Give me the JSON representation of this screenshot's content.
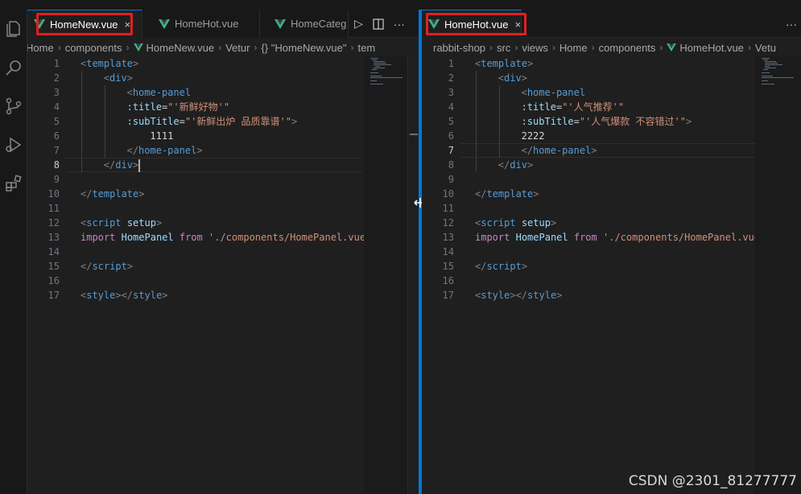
{
  "left": {
    "tabs": [
      {
        "label": "HomeNew.vue",
        "active": true,
        "close": "×"
      },
      {
        "label": "HomeHot.vue",
        "active": false
      },
      {
        "label": "HomeCateg",
        "active": false
      }
    ],
    "breadcrumb": [
      "Home",
      "components",
      "HomeNew.vue",
      "Vetur",
      "{} \"HomeNew.vue\"",
      "tem"
    ],
    "cursor_line": 8,
    "lines": [
      {
        "n": "1",
        "tokens": [
          [
            "t-brk",
            "<"
          ],
          [
            "t-tag",
            "template"
          ],
          [
            "t-brk",
            ">"
          ]
        ]
      },
      {
        "n": "2",
        "indent": 1,
        "tokens": [
          [
            "t-brk",
            "<"
          ],
          [
            "t-tag",
            "div"
          ],
          [
            "t-brk",
            ">"
          ]
        ]
      },
      {
        "n": "3",
        "indent": 2,
        "tokens": [
          [
            "t-brk",
            "<"
          ],
          [
            "t-tag",
            "home-panel"
          ]
        ]
      },
      {
        "n": "4",
        "indent": 2,
        "tokens": [
          [
            "t-attr",
            ":title"
          ],
          [
            "t-txt",
            "="
          ],
          [
            "t-str",
            "\"'新鲜好物'\""
          ]
        ]
      },
      {
        "n": "5",
        "indent": 2,
        "tokens": [
          [
            "t-attr",
            ":subTitle"
          ],
          [
            "t-txt",
            "="
          ],
          [
            "t-str",
            "\"'新鲜出炉 品质靠谱'\""
          ],
          [
            "t-brk",
            ">"
          ]
        ]
      },
      {
        "n": "6",
        "indent": 3,
        "tokens": [
          [
            "t-txt",
            "1111"
          ]
        ]
      },
      {
        "n": "7",
        "indent": 2,
        "tokens": [
          [
            "t-brk",
            "</"
          ],
          [
            "t-tag",
            "home-panel"
          ],
          [
            "t-brk",
            ">"
          ]
        ]
      },
      {
        "n": "8",
        "indent": 1,
        "tokens": [
          [
            "t-brk",
            "</"
          ],
          [
            "t-tag",
            "div"
          ],
          [
            "t-brk",
            ">"
          ]
        ],
        "cursor": true
      },
      {
        "n": "9",
        "tokens": []
      },
      {
        "n": "10",
        "tokens": [
          [
            "t-brk",
            "</"
          ],
          [
            "t-tag",
            "template"
          ],
          [
            "t-brk",
            ">"
          ]
        ]
      },
      {
        "n": "11",
        "tokens": []
      },
      {
        "n": "12",
        "tokens": [
          [
            "t-brk",
            "<"
          ],
          [
            "t-tag",
            "script"
          ],
          [
            "t-txt",
            " "
          ],
          [
            "t-sup",
            "setup"
          ],
          [
            "t-brk",
            ">"
          ]
        ]
      },
      {
        "n": "13",
        "tokens": [
          [
            "t-kw",
            "import"
          ],
          [
            "t-txt",
            " "
          ],
          [
            "t-var",
            "HomePanel"
          ],
          [
            "t-txt",
            " "
          ],
          [
            "t-kw",
            "from"
          ],
          [
            "t-txt",
            " "
          ],
          [
            "t-str",
            "'./components/HomePanel.vue"
          ]
        ]
      },
      {
        "n": "14",
        "tokens": []
      },
      {
        "n": "15",
        "tokens": [
          [
            "t-brk",
            "</"
          ],
          [
            "t-tag",
            "script"
          ],
          [
            "t-brk",
            ">"
          ]
        ]
      },
      {
        "n": "16",
        "tokens": []
      },
      {
        "n": "17",
        "tokens": [
          [
            "t-brk",
            "<"
          ],
          [
            "t-tag",
            "style"
          ],
          [
            "t-brk",
            "></"
          ],
          [
            "t-tag",
            "style"
          ],
          [
            "t-brk",
            ">"
          ]
        ]
      }
    ]
  },
  "right": {
    "tabs": [
      {
        "label": "HomeHot.vue",
        "active": true,
        "close": "×"
      }
    ],
    "breadcrumb": [
      "rabbit-shop",
      "src",
      "views",
      "Home",
      "components",
      "HomeHot.vue",
      "Vetu"
    ],
    "cursor_line": 7,
    "lines": [
      {
        "n": "1",
        "tokens": [
          [
            "t-brk",
            "<"
          ],
          [
            "t-tag",
            "template"
          ],
          [
            "t-brk",
            ">"
          ]
        ]
      },
      {
        "n": "2",
        "indent": 1,
        "tokens": [
          [
            "t-brk",
            "<"
          ],
          [
            "t-tag",
            "div"
          ],
          [
            "t-brk",
            ">"
          ]
        ]
      },
      {
        "n": "3",
        "indent": 2,
        "tokens": [
          [
            "t-brk",
            "<"
          ],
          [
            "t-tag",
            "home-panel"
          ]
        ]
      },
      {
        "n": "4",
        "indent": 2,
        "tokens": [
          [
            "t-attr",
            ":title"
          ],
          [
            "t-txt",
            "="
          ],
          [
            "t-str",
            "\"'人气推荐'\""
          ]
        ]
      },
      {
        "n": "5",
        "indent": 2,
        "tokens": [
          [
            "t-attr",
            ":subTitle"
          ],
          [
            "t-txt",
            "="
          ],
          [
            "t-str",
            "\"'人气爆款 不容错过'\""
          ],
          [
            "t-brk",
            ">"
          ]
        ]
      },
      {
        "n": "6",
        "indent": 2,
        "tokens": [
          [
            "t-txt",
            "2222"
          ]
        ]
      },
      {
        "n": "7",
        "indent": 2,
        "tokens": [
          [
            "t-brk",
            "</"
          ],
          [
            "t-tag",
            "home-panel"
          ],
          [
            "t-brk",
            ">"
          ]
        ]
      },
      {
        "n": "8",
        "indent": 1,
        "tokens": [
          [
            "t-brk",
            "</"
          ],
          [
            "t-tag",
            "div"
          ],
          [
            "t-brk",
            ">"
          ]
        ]
      },
      {
        "n": "9",
        "tokens": []
      },
      {
        "n": "10",
        "tokens": [
          [
            "t-brk",
            "</"
          ],
          [
            "t-tag",
            "template"
          ],
          [
            "t-brk",
            ">"
          ]
        ]
      },
      {
        "n": "11",
        "tokens": []
      },
      {
        "n": "12",
        "tokens": [
          [
            "t-brk",
            "<"
          ],
          [
            "t-tag",
            "script"
          ],
          [
            "t-txt",
            " "
          ],
          [
            "t-sup",
            "setup"
          ],
          [
            "t-brk",
            ">"
          ]
        ]
      },
      {
        "n": "13",
        "tokens": [
          [
            "t-kw",
            "import"
          ],
          [
            "t-txt",
            " "
          ],
          [
            "t-var",
            "HomePanel"
          ],
          [
            "t-txt",
            " "
          ],
          [
            "t-kw",
            "from"
          ],
          [
            "t-txt",
            " "
          ],
          [
            "t-str",
            "'./components/HomePanel.vue"
          ]
        ]
      },
      {
        "n": "14",
        "tokens": []
      },
      {
        "n": "15",
        "tokens": [
          [
            "t-brk",
            "</"
          ],
          [
            "t-tag",
            "script"
          ],
          [
            "t-brk",
            ">"
          ]
        ]
      },
      {
        "n": "16",
        "tokens": []
      },
      {
        "n": "17",
        "tokens": [
          [
            "t-brk",
            "<"
          ],
          [
            "t-tag",
            "style"
          ],
          [
            "t-brk",
            "></"
          ],
          [
            "t-tag",
            "style"
          ],
          [
            "t-brk",
            ">"
          ]
        ]
      }
    ]
  },
  "tab_actions": {
    "run": "▷",
    "split": "split-editor-icon",
    "more": "···"
  },
  "watermark": "CSDN @2301_81277777",
  "colors": {
    "accent": "#0078d4",
    "highlight_box": "#e02020",
    "vue_green": "#41b883"
  }
}
